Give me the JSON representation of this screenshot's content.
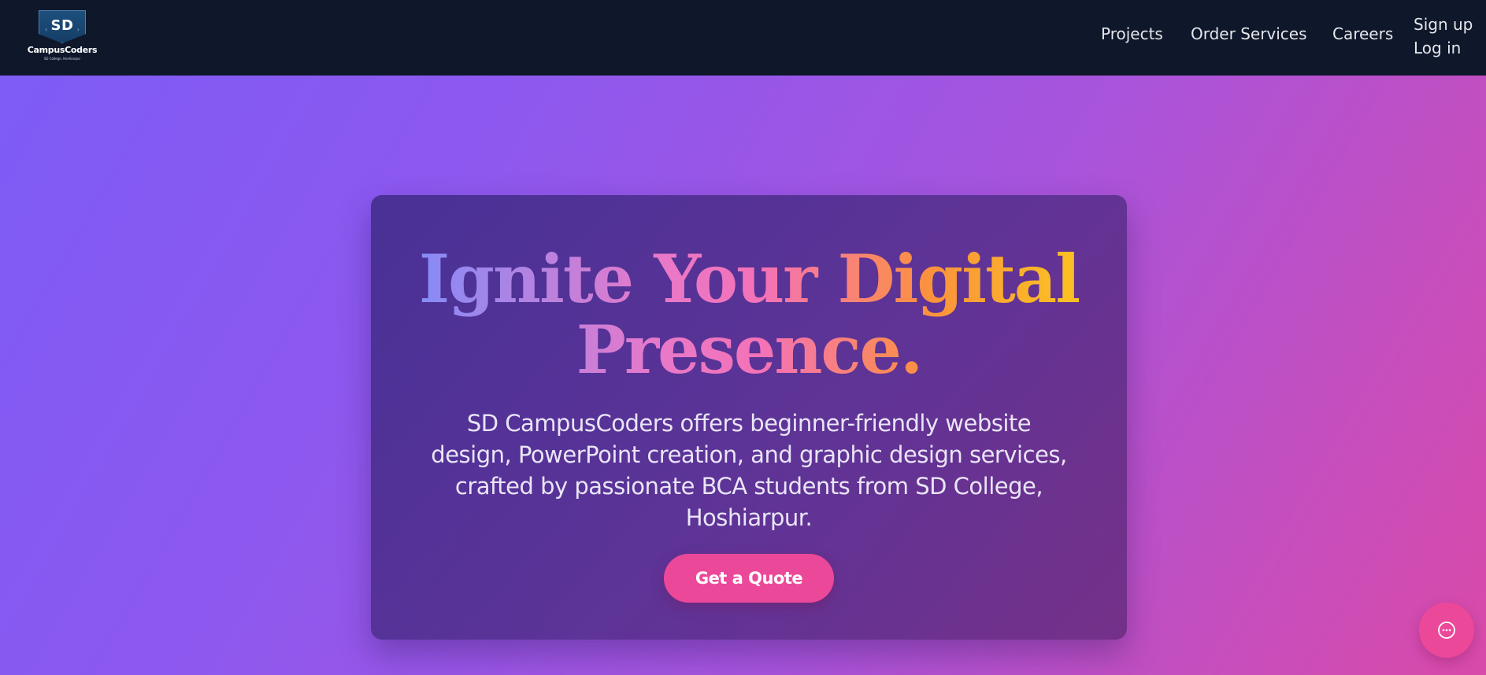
{
  "header": {
    "logo": {
      "mark_text": "SD",
      "name": "CampusCoders",
      "subtitle": "SD College, Hoshiarpur"
    },
    "nav": [
      {
        "label": "Projects"
      },
      {
        "label": "Order Services"
      },
      {
        "label": "Careers"
      }
    ],
    "auth": {
      "signup_label": "Sign up",
      "login_label": "Log in"
    }
  },
  "hero": {
    "title_line1": "Ignite Your Digital",
    "title_line2": "Presence.",
    "description": "SD CampusCoders offers beginner-friendly website design, PowerPoint creation, and graphic design services, crafted by passionate BCA students from SD College, Hoshiarpur.",
    "cta_label": "Get a Quote"
  },
  "chat": {
    "icon": "chat-bubble-icon"
  },
  "colors": {
    "header_bg": "#0f172a",
    "accent_pink": "#ec4899",
    "gradient_start": "#7c5cf6",
    "gradient_end": "#d94aa9"
  }
}
